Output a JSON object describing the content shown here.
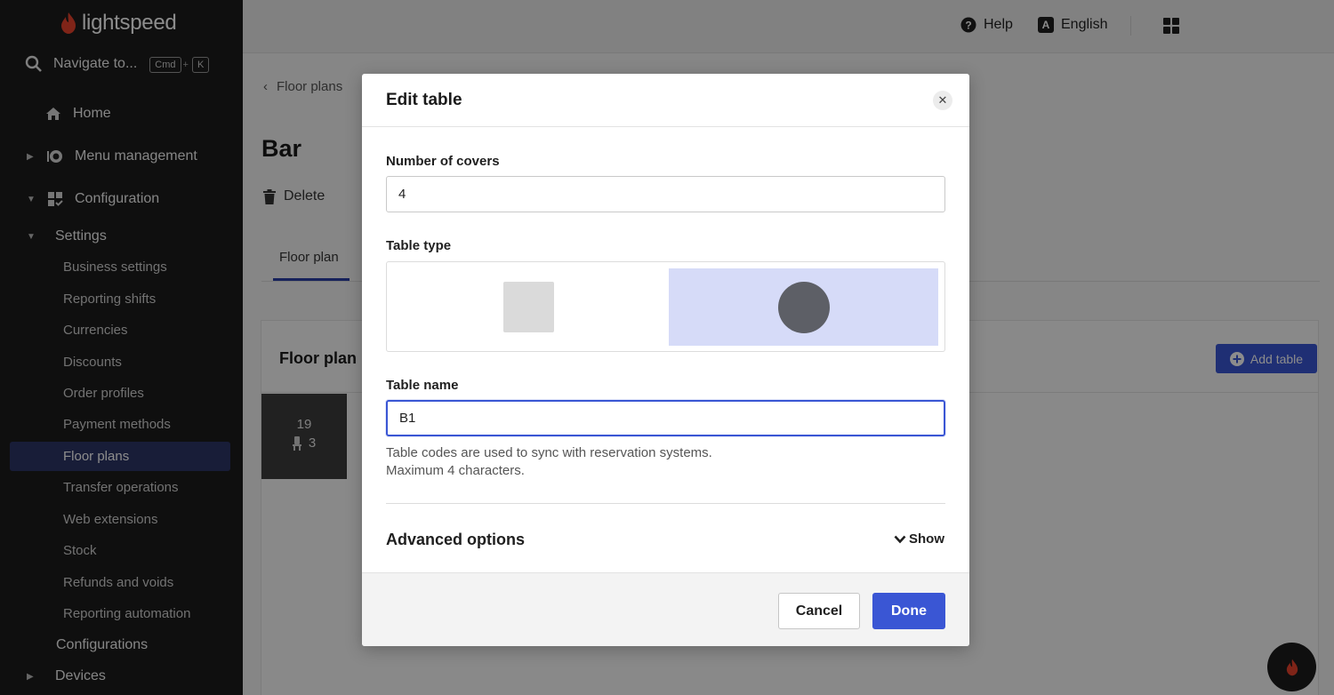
{
  "brand": {
    "name": "lightspeed",
    "accent": "#e8432c"
  },
  "sidebar": {
    "search_label": "Navigate to...",
    "shortcut_key1": "Cmd",
    "shortcut_plus": "+",
    "shortcut_key2": "K",
    "home": "Home",
    "menu_management": "Menu management",
    "configuration": "Configuration",
    "settings": "Settings",
    "settings_items": [
      "Business settings",
      "Reporting shifts",
      "Currencies",
      "Discounts",
      "Order profiles",
      "Payment methods",
      "Floor plans",
      "Transfer operations",
      "Web extensions",
      "Stock",
      "Refunds and voids",
      "Reporting automation"
    ],
    "configurations": "Configurations",
    "devices": "Devices"
  },
  "topbar": {
    "help": "Help",
    "language": "English",
    "language_icon_letter": "A"
  },
  "page": {
    "back_label": "Floor plans",
    "title": "Bar",
    "delete_label": "Delete",
    "tab_label": "Floor plan",
    "panel_title": "Floor plan",
    "add_table_label": "Add table",
    "table_tile": {
      "number": "19",
      "covers": "3"
    }
  },
  "modal": {
    "title": "Edit table",
    "covers_label": "Number of covers",
    "covers_value": "4",
    "table_type_label": "Table type",
    "table_type_selected": "round",
    "table_name_label": "Table name",
    "table_name_value": "B1",
    "help_line1": "Table codes are used to sync with reservation systems.",
    "help_line2": "Maximum 4 characters.",
    "advanced_label": "Advanced options",
    "advanced_toggle": "Show",
    "cancel_label": "Cancel",
    "done_label": "Done"
  }
}
